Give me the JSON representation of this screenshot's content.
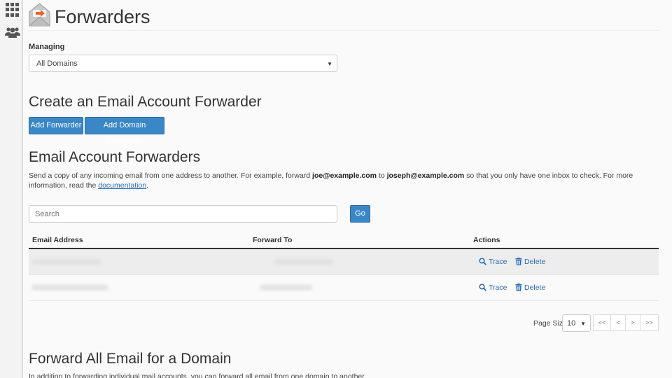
{
  "sidebar": {
    "items": [
      {
        "icon": "apps-grid-icon"
      },
      {
        "icon": "users-icon"
      }
    ]
  },
  "header": {
    "title": "Forwarders",
    "icon": "forwarders-envelope-icon"
  },
  "managing": {
    "label": "Managing",
    "selected": "All Domains"
  },
  "create_section": {
    "heading": "Create an Email Account Forwarder",
    "add_forwarder_label": "Add Forwarder",
    "add_domain_forwarder_label": "Add Domain Forwarder"
  },
  "forwarders_section": {
    "heading": "Email Account Forwarders",
    "description_part1": "Send a copy of any incoming email from one address to another. For example, forward ",
    "example_from": "joe@example.com",
    "description_part2": " to ",
    "example_to": "joseph@example.com",
    "description_part3": " so that you only have one inbox to check. For more information, read the ",
    "link_text": "documentation",
    "description_end": "."
  },
  "search": {
    "placeholder": "Search",
    "go_label": "Go"
  },
  "table": {
    "columns": [
      "Email Address",
      "Forward To",
      "Actions"
    ],
    "rows": [
      {
        "email": "",
        "forward_to": "",
        "actions": [
          "Trace",
          "Delete"
        ]
      },
      {
        "email": "",
        "forward_to": "",
        "actions": [
          "Trace",
          "Delete"
        ]
      }
    ]
  },
  "pagination": {
    "page_size_label": "Page Size",
    "page_size": "10",
    "buttons": [
      "<<",
      "<",
      ">",
      ">>"
    ]
  },
  "forward_all_section": {
    "heading": "Forward All Email for a Domain",
    "description": "In addition to forwarding individual mail accounts, you can forward all email from one domain to another."
  },
  "colors": {
    "primary_button": "#3a87c8",
    "link": "#2a6db5",
    "accent_orange": "#e8632c"
  }
}
